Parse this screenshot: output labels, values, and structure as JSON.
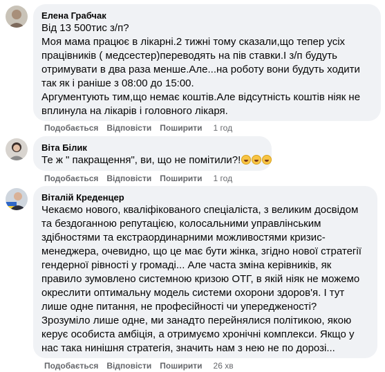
{
  "comments": [
    {
      "author": "Елена Грабчак",
      "lines": [
        "Від 13 500тис з/п?",
        "Моя мама працює в лікарні.2 тижні тому сказали,що тепер усіх",
        "працівників ( медсестер)переводять на пів ставки.І з/п будуть",
        "отримувати в два раза менше.Але...на роботу вони будуть ходити",
        "так як і раніше з 08:00 до 15:00.",
        "Аргументують тим,що немає коштів.Але відсутність коштів ніяк не",
        "вплинула на лікарів і головного лікаря."
      ],
      "like": "Подобається",
      "reply": "Відповісти",
      "share": "Поширити",
      "time": "1 год"
    },
    {
      "author": "Віта Білик",
      "lines": [
        "Те ж \" пакращення\", ви, що не помітили?!"
      ],
      "emoji_icons": [
        "laughing-crying-emoji",
        "laughing-crying-emoji",
        "laughing-crying-emoji"
      ],
      "like": "Подобається",
      "reply": "Відповісти",
      "share": "Поширити",
      "time": "1 год"
    },
    {
      "author": "Віталій Креденцер",
      "lines": [
        "Чекаємо нового, кваліфікованого спеціаліста, з великим досвідом",
        "та бездоганною репутацією, колосальними управлінським",
        "здібностями та екстраординарними можливостями кризис-",
        "менеджера, очевидно, що це має бути жінка, згідно нової стратегії",
        "гендерної рівності у громаді... Але часта зміна керівників, як",
        "правило зумовлено системною кризою ОТГ, в якій ніяк не можемо",
        "окреслити оптимальну модель системи охорони здоров'я. І тут",
        "лише одне питання, не професійності чи упередженості?",
        "Зрозуміло лише одне, ми занадто перейнялися політикою, якою",
        "керує особиста амбіція, а отримуємо хронічні комплекси. Якщо у",
        "нас така нинішня стратегія, значить нам з нею не по дорозі..."
      ],
      "like": "Подобається",
      "reply": "Відповісти",
      "share": "Поширити",
      "time": "26 хв"
    }
  ],
  "colors": {
    "bubble": "#f0f2f5",
    "meta": "#65676b",
    "text": "#050505"
  }
}
